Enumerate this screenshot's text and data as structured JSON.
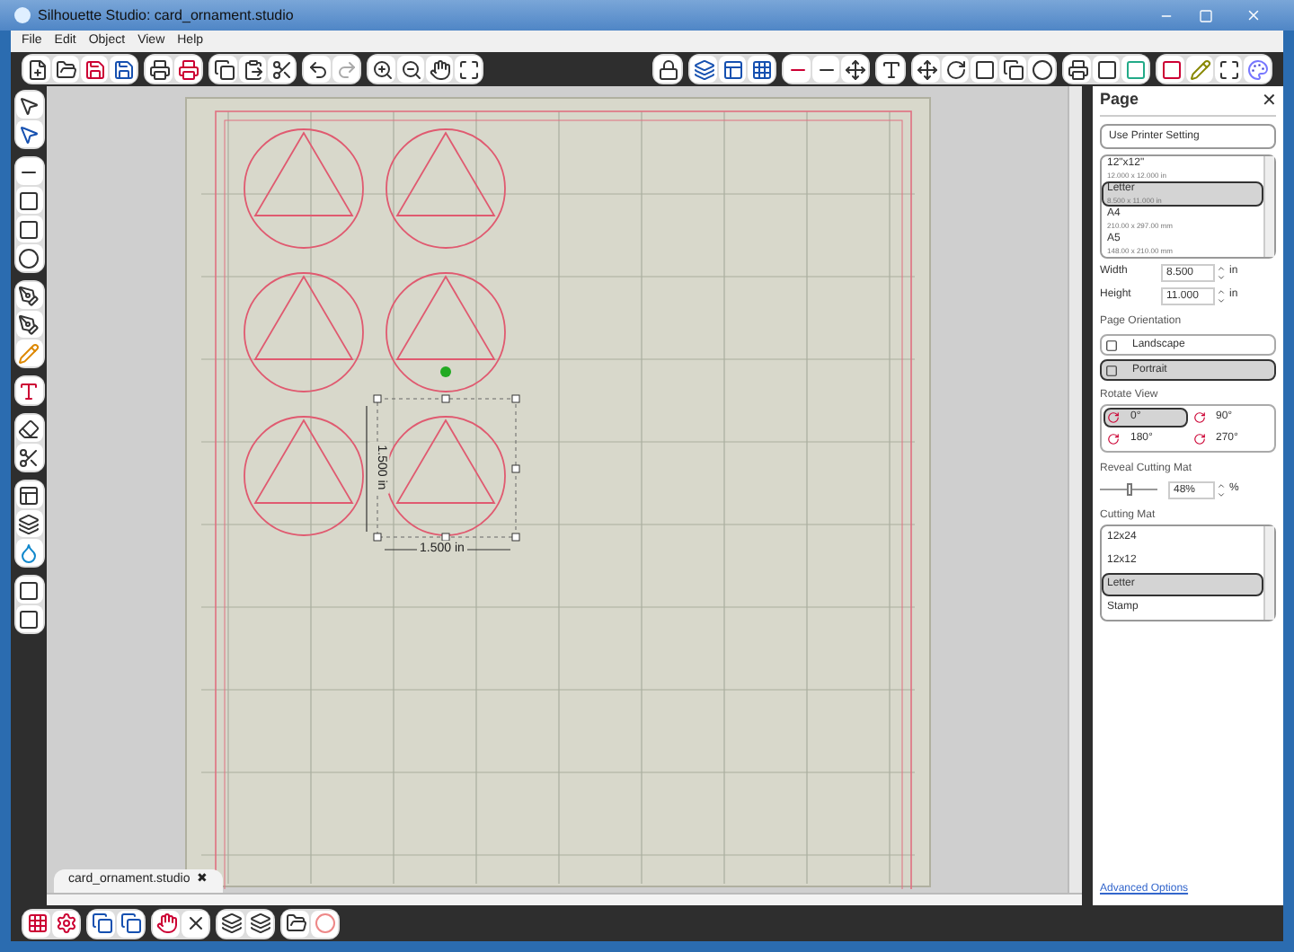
{
  "window": {
    "title": "Silhouette Studio: card_ornament.studio"
  },
  "menu": [
    {
      "label": "File"
    },
    {
      "label": "Edit"
    },
    {
      "label": "Object"
    },
    {
      "label": "View"
    },
    {
      "label": "Help"
    }
  ],
  "canvas": {
    "width_label": "1.500 in",
    "height_label": "1.500 in"
  },
  "document_tab": {
    "label": "card_ornament.studio",
    "close": "✖"
  },
  "panel": {
    "title": "Page",
    "close": "✕",
    "printer_button": "Use Printer Setting",
    "paper_sizes": [
      {
        "name": "12\"x12\"",
        "size": "12.000 x 12.000 in",
        "selected": false
      },
      {
        "name": "Letter",
        "size": "8.500 x 11.000 in",
        "selected": true
      },
      {
        "name": "A4",
        "size": "210.00 x 297.00 mm",
        "selected": false
      },
      {
        "name": "A5",
        "size": "148.00 x 210.00 mm",
        "selected": false
      }
    ],
    "width": {
      "label": "Width",
      "value": "8.500",
      "unit": "in"
    },
    "height": {
      "label": "Height",
      "value": "11.000",
      "unit": "in"
    },
    "orientation_label": "Page Orientation",
    "orientations": [
      {
        "label": "Landscape",
        "selected": false
      },
      {
        "label": "Portrait",
        "selected": true
      }
    ],
    "rotate_label": "Rotate View",
    "rotations": [
      {
        "label": "0°",
        "selected": true
      },
      {
        "label": "90°",
        "selected": false
      },
      {
        "label": "180°",
        "selected": false
      },
      {
        "label": "270°",
        "selected": false
      }
    ],
    "reveal_label": "Reveal Cutting Mat",
    "reveal": {
      "level": 0.48,
      "value": "48%",
      "unit": "%"
    },
    "mat_label": "Cutting Mat",
    "mats": [
      {
        "label": "12x24",
        "selected": false
      },
      {
        "label": "12x12",
        "selected": false
      },
      {
        "label": "Letter",
        "selected": true
      },
      {
        "label": "Stamp",
        "selected": false
      }
    ],
    "advanced_link": "Advanced Options"
  }
}
